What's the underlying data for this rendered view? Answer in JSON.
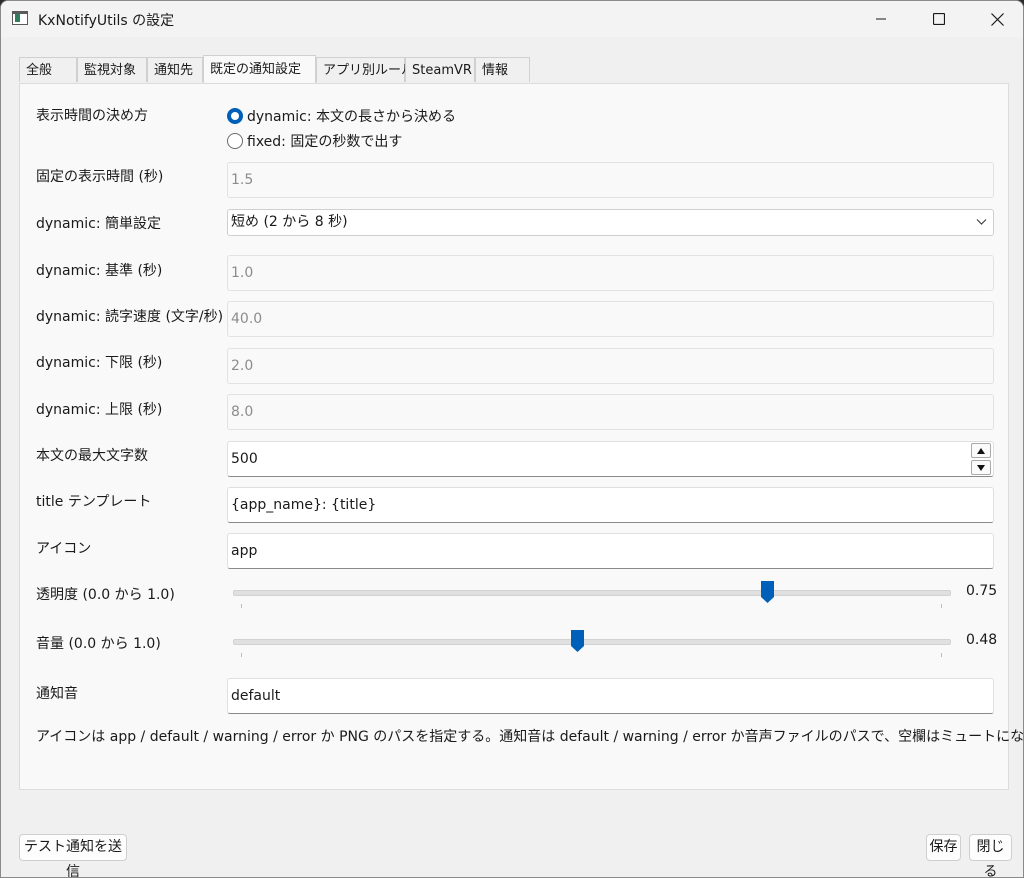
{
  "window": {
    "title": "KxNotifyUtils の設定"
  },
  "tabs": [
    {
      "label": "全般"
    },
    {
      "label": "監視対象"
    },
    {
      "label": "通知先"
    },
    {
      "label": "既定の通知設定"
    },
    {
      "label": "アプリ別ルール"
    },
    {
      "label": "SteamVR"
    },
    {
      "label": "情報"
    }
  ],
  "active_tab": "既定の通知設定",
  "form": {
    "duration_mode_label": "表示時間の決め方",
    "duration_mode_options": [
      {
        "label": "dynamic: 本文の長さから決める",
        "selected": true
      },
      {
        "label": "fixed: 固定の秒数で出す",
        "selected": false
      }
    ],
    "fixed_duration_label": "固定の表示時間 (秒)",
    "fixed_duration_value": "1.5",
    "dynamic_preset_label": "dynamic: 簡単設定",
    "dynamic_preset_value": "短め (2 から 8 秒)",
    "dynamic_base_label": "dynamic: 基準 (秒)",
    "dynamic_base_value": "1.0",
    "dynamic_speed_label": "dynamic: 読字速度 (文字/秒)",
    "dynamic_speed_value": "40.0",
    "dynamic_min_label": "dynamic: 下限 (秒)",
    "dynamic_min_value": "2.0",
    "dynamic_max_label": "dynamic: 上限 (秒)",
    "dynamic_max_value": "8.0",
    "max_chars_label": "本文の最大文字数",
    "max_chars_value": "500",
    "title_template_label": "title テンプレート",
    "title_template_value": "{app_name}: {title}",
    "icon_label": "アイコン",
    "icon_value": "app",
    "opacity_label": "透明度 (0.0 から 1.0)",
    "opacity_value": "0.75",
    "volume_label": "音量 (0.0 から 1.0)",
    "volume_value": "0.48",
    "sound_label": "通知音",
    "sound_value": "default",
    "hint": "アイコンは app / default / warning / error か PNG のパスを指定する。通知音は default / warning / error か音声ファイルのパスで、空欄はミュートになる。"
  },
  "buttons": {
    "test_send": "テスト通知を送信",
    "save": "保存",
    "close": "閉じる"
  },
  "colors": {
    "accent": "#005fb8"
  }
}
